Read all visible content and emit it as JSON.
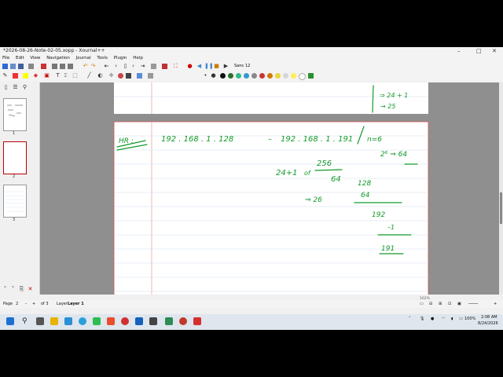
{
  "window": {
    "title": "*2026-08-26-Note-02-05.xopp - Xournal++",
    "minimize": "–",
    "maximize": "□",
    "close": "✕"
  },
  "menu": [
    "File",
    "Edit",
    "View",
    "Navigation",
    "Journal",
    "Tools",
    "Plugin",
    "Help"
  ],
  "toolbar": {
    "layout_label": "Sans",
    "font_size": "12"
  },
  "sidebar": {
    "pages": [
      {
        "label": "1"
      },
      {
        "label": "2",
        "selected": true
      },
      {
        "label": "3"
      }
    ]
  },
  "notes": {
    "prev_page": {
      "line1": "⇒ 24 + 1",
      "line2": "→ 25"
    },
    "current_page": {
      "hr_label": "HR :",
      "range_start": "192 . 168 . 1 . 128",
      "range_dash": "–",
      "range_end": "192 . 168 . 1 . 191",
      "n_eq": "n=6",
      "pow_eq": "2⁶ ⇒ 64",
      "calc_left": "24+1",
      "calc_of": "of",
      "frac_top": "256",
      "frac_bottom": "64",
      "arrow_26": "⇒ 26",
      "sum_top": "128",
      "sum_add": "64",
      "sum_res": "192",
      "sub": "–1",
      "final": "191"
    }
  },
  "status": {
    "page_label": "Page",
    "page_value": "2",
    "page_of": "of 3",
    "layer_label": "Layer",
    "layer_value": "Layer 1",
    "zoom": "162%"
  },
  "taskbar": {
    "time": "2:08 AM",
    "date": "8/24/2026",
    "battery": "100%"
  }
}
